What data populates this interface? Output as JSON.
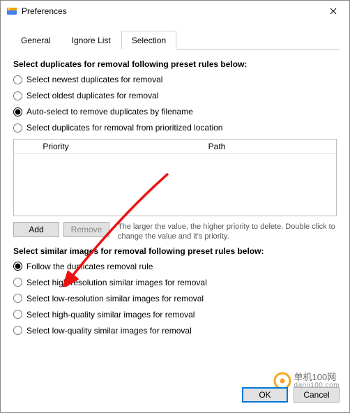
{
  "window": {
    "title": "Preferences"
  },
  "tabs": {
    "general": "General",
    "ignore": "Ignore List",
    "selection": "Selection"
  },
  "section1": {
    "title": "Select duplicates for removal following preset rules below:",
    "opt_newest": "Select newest duplicates for removal",
    "opt_oldest": "Select oldest duplicates for removal",
    "opt_filename": "Auto-select to remove duplicates by filename",
    "opt_priority": "Select duplicates for removal from prioritized location"
  },
  "table": {
    "col_priority": "Priority",
    "col_path": "Path",
    "rows": []
  },
  "buttons": {
    "add": "Add",
    "remove": "Remove"
  },
  "hint": "The larger the value, the higher priority to delete. Double click to change the value and it's priority.",
  "section2": {
    "title": "Select similar images for removal following preset rules below:",
    "opt_follow": "Follow the duplicates removal rule",
    "opt_highres": "Select high-resolution similar images for removal",
    "opt_lowres": "Select low-resolution similar images for removal",
    "opt_highq": "Select high-quality similar images for removal",
    "opt_lowq": "Select low-quality similar images for removal"
  },
  "footer": {
    "ok": "OK",
    "cancel": "Cancel"
  },
  "watermark": {
    "line1": "单机100网",
    "line2": "danji100.com"
  }
}
